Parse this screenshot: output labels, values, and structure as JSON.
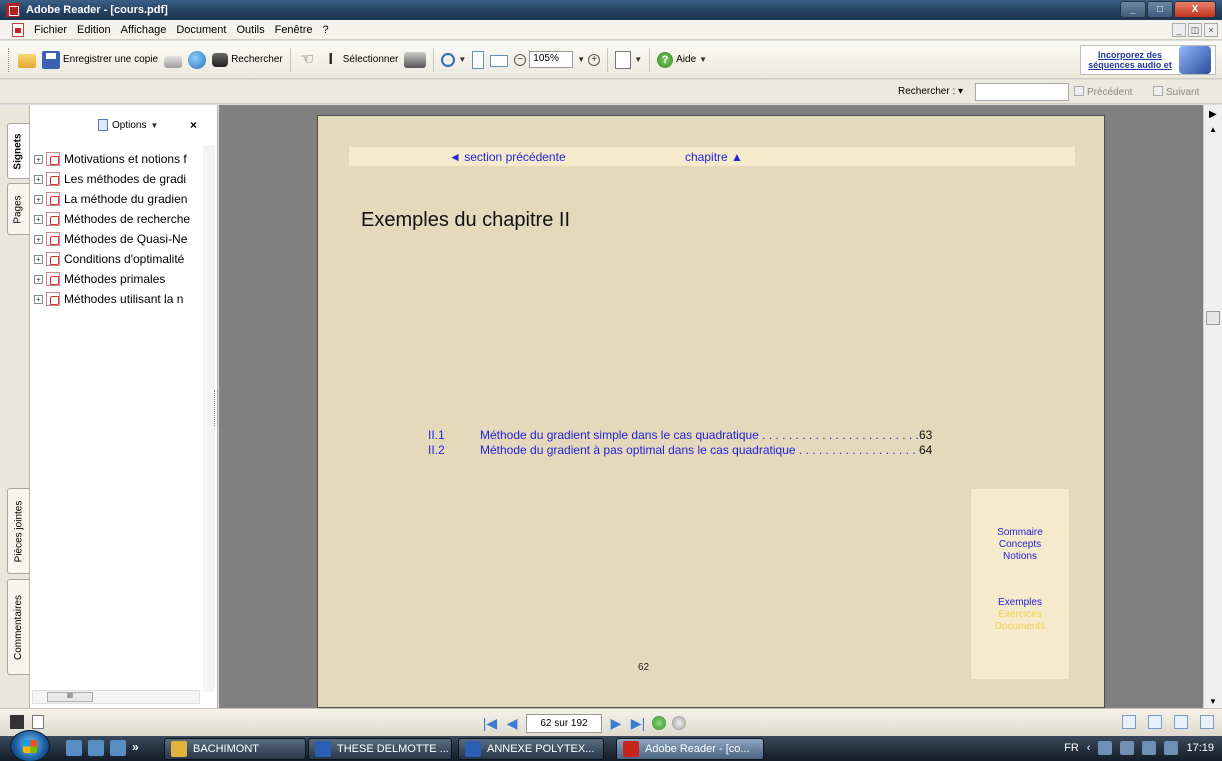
{
  "window": {
    "title": "Adobe Reader - [cours.pdf]",
    "controls": {
      "minimize": "_",
      "maximize": "□",
      "close": "X"
    }
  },
  "menu": {
    "items": [
      "Fichier",
      "Edition",
      "Affichage",
      "Document",
      "Outils",
      "Fenêtre",
      "?"
    ],
    "mdi": {
      "minimize": "_",
      "restore": "◫",
      "close": "×"
    }
  },
  "toolbar": {
    "save_copy": "Enregistrer une copie",
    "search": "Rechercher",
    "select": "Sélectionner",
    "zoom": "105%",
    "help": "Aide",
    "promo": "Incorporez des séquences audio et"
  },
  "searchbar": {
    "label": "Rechercher :",
    "previous": "Précédent",
    "next": "Suivant"
  },
  "sidetabs": [
    "Signets",
    "Pages",
    "Pièces jointes",
    "Commentaires"
  ],
  "panel": {
    "options": "Options",
    "close": "×",
    "bookmarks": [
      "Motivations et notions f",
      "Les méthodes de gradi",
      "La méthode du gradien",
      "Méthodes de recherche",
      "Méthodes de Quasi-Ne",
      "Conditions d'optimalité",
      "Méthodes primales",
      "Méthodes utilisant la n"
    ],
    "hscroll_thumb": "III"
  },
  "page": {
    "nav_prev": "◄ section précédente",
    "nav_chapter": "chapitre ▲",
    "title": "Exemples du chapitre II",
    "toc": [
      {
        "num": "II.1",
        "text": "Méthode du gradient simple dans le cas quadratique . . . . . . . . . . . . . . . . . . . . . . . . . . .",
        "page": "63"
      },
      {
        "num": "II.2",
        "text": "Méthode du gradient à pas optimal dans le cas quadratique . . . . . . . . . . . . . . . . . . . . . . . . . . .",
        "page": "64"
      }
    ],
    "side_links_1": [
      "Sommaire",
      "Concepts",
      "Notions"
    ],
    "side_link_exemples": "Exemples",
    "side_link_exercices": "Exercices",
    "side_link_documents": "Documents",
    "page_number": "62"
  },
  "statusbar": {
    "page_field": "62 sur 192"
  },
  "taskbar": {
    "buttons": [
      "BACHIMONT",
      "THESE DELMOTTE ...",
      "ANNEXE POLYTEX...",
      "Adobe Reader - [co..."
    ],
    "lang": "FR",
    "time": "17:19"
  },
  "colors": {
    "link": "#2323d9",
    "page_bg": "#e4d9bd",
    "band_bg": "#f5eacb",
    "muted_link": "#f3d24a"
  }
}
